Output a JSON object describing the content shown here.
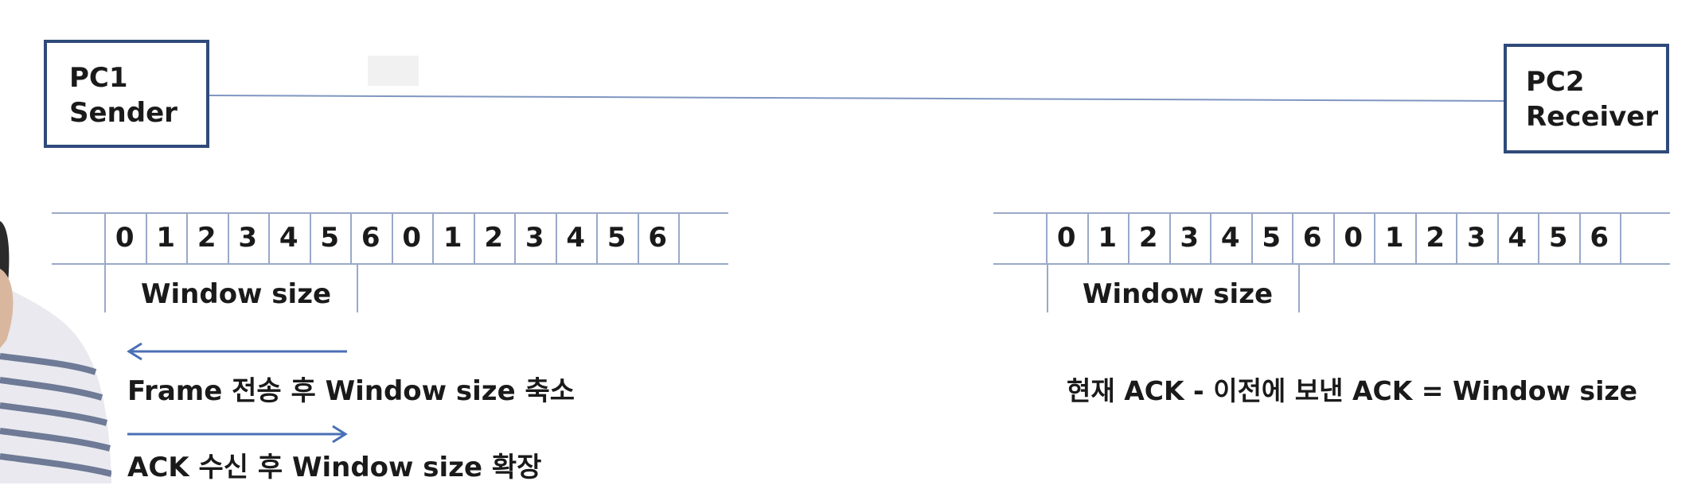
{
  "nodes": {
    "pc1": {
      "line1": "PC1",
      "line2": "Sender"
    },
    "pc2": {
      "line1": "PC2",
      "line2": "Receiver"
    }
  },
  "sender_strip": {
    "sequence": [
      "0",
      "1",
      "2",
      "3",
      "4",
      "5",
      "6",
      "0",
      "1",
      "2",
      "3",
      "4",
      "5",
      "6"
    ],
    "window_label": "Window size"
  },
  "receiver_strip": {
    "sequence": [
      "0",
      "1",
      "2",
      "3",
      "4",
      "5",
      "6",
      "0",
      "1",
      "2",
      "3",
      "4",
      "5",
      "6"
    ],
    "window_label": "Window size"
  },
  "captions": {
    "shrink": "Frame 전송 후 Window size 축소",
    "expand": "ACK 수신 후 Window size 확장",
    "receiver_formula": "현재 ACK - 이전에 보낸 ACK = Window size"
  },
  "colors": {
    "box_border": "#2f4a7a",
    "arrow": "#4a6fb5",
    "link_line": "#7f96c2",
    "grid_line": "#9aa9c8"
  },
  "icons": {
    "left_arrow": "arrow-left-icon",
    "right_arrow": "arrow-right-icon"
  }
}
